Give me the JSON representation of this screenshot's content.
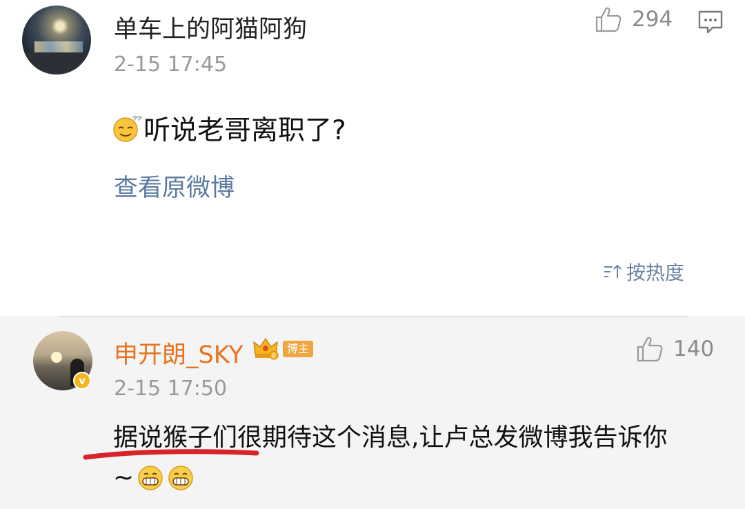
{
  "main_comment": {
    "username": "单车上的阿猫阿狗",
    "timestamp": "2-15 17:45",
    "like_count": "294",
    "content": "听说老哥离职了?",
    "content_emoji": "thinking-face-emoji",
    "view_original_label": "查看原微博"
  },
  "sort": {
    "label": "按热度",
    "icon": "sort-icon"
  },
  "reply": {
    "username": "申开朗_SKY",
    "crown_icon": "crown-icon",
    "badge_label": "博主",
    "timestamp": "2-15 17:50",
    "like_count": "140",
    "content_line1": "据说猴子们很期待这个消息,让卢总发微博我告诉你",
    "content_line2": "~",
    "content_emojis": [
      "grinning-face-emoji",
      "grinning-face-emoji"
    ],
    "annotation": "red-underline-mark"
  },
  "colors": {
    "background": "#ffffff",
    "reply_background": "#f4f4f4",
    "username_primary": "#222222",
    "username_blogger": "#e8731f",
    "link_blue": "#5b7a9f",
    "timestamp_gray": "#999999",
    "underline_red": "#d8232a",
    "badge_gold": "#f0a640"
  }
}
